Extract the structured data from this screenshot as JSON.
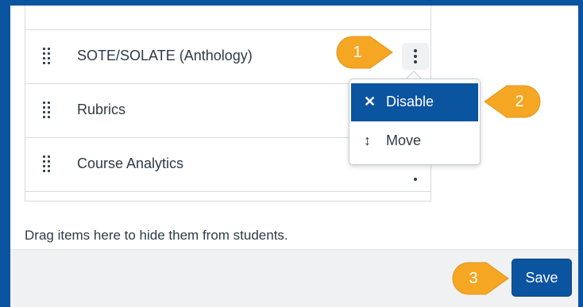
{
  "nav_items": [
    {
      "label": "SOTE/SOLATE (Anthology)"
    },
    {
      "label": "Rubrics"
    },
    {
      "label": "Course Analytics"
    }
  ],
  "menu": {
    "disable": {
      "icon": "✕",
      "label": "Disable"
    },
    "move": {
      "icon": "↕",
      "label": "Move"
    }
  },
  "hint": "Drag items here to hide them from students.",
  "save_label": "Save",
  "callouts": [
    "1",
    "2",
    "3"
  ],
  "colors": {
    "primary": "#0b54a0",
    "callout": "#f5a623",
    "text": "#2d3b45"
  }
}
